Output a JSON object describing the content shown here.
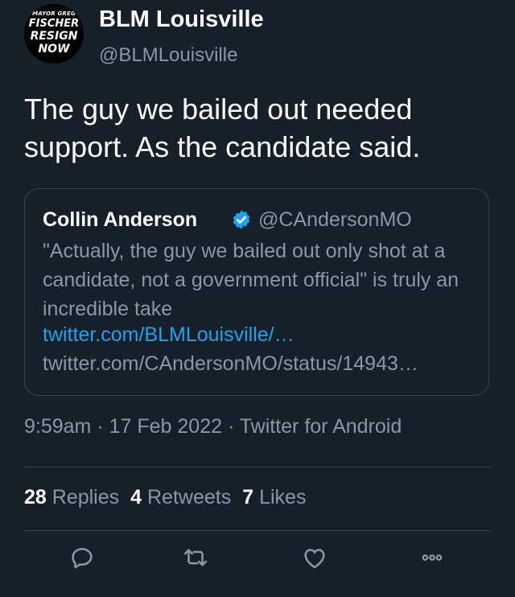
{
  "tweet": {
    "avatar": {
      "line1": "MAYOR GREG",
      "line2": "FISCHER",
      "line3": "RESIGN",
      "line4": "NOW"
    },
    "display_name": "BLM Louisville",
    "handle": "@BLMLouisville",
    "text": "The guy we bailed out needed support. As the candidate said.",
    "quoted": {
      "name": "Collin Anderson",
      "verified_icon": "verified-badge-icon",
      "handle": "@CAndersonMO",
      "text": "\"Actually, the guy we bailed out only shot at a candidate, not a government official\" is truly an incredible take",
      "link1": "twitter.com/BLMLouisville/…",
      "link2": "twitter.com/CAndersonMO/status/14943…"
    },
    "meta": "9:59am · 17 Feb 2022 · Twitter for Android",
    "stats": {
      "replies_count": "28",
      "replies_label": "Replies",
      "retweets_count": "4",
      "retweets_label": "Retweets",
      "likes_count": "7",
      "likes_label": "Likes"
    },
    "actions": [
      "reply-icon",
      "retweet-icon",
      "like-icon",
      "more-icon"
    ]
  },
  "colors": {
    "background": "#15202b",
    "secondary_text": "#8899a6",
    "link": "#1da1f2",
    "border": "#38444d",
    "verified": "#1da1f2"
  }
}
